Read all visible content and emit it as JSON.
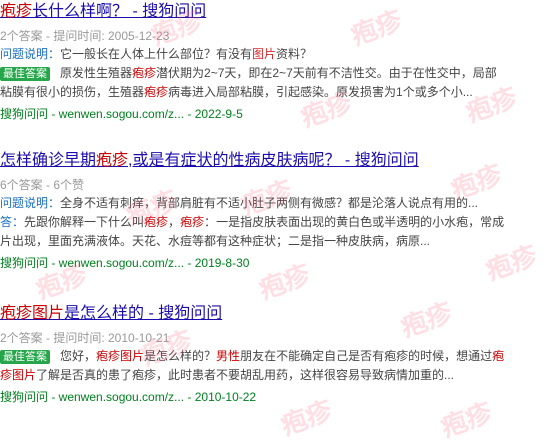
{
  "watermark_text": "疱疹",
  "watermark_color": "#ff5a78",
  "results": [
    {
      "title": {
        "hl": "疱疹",
        "rest": "长什么样啊？ - 搜狗问问"
      },
      "meta": "2个答案 - 提问时间: 2005-12-23",
      "question": {
        "label": "问题说明：",
        "pre": "它一般长在人体上什么部位？有没有",
        "hl": "图片",
        "post": "资料？"
      },
      "answer": {
        "badge": "最佳答案",
        "line1_pre": "原发性生殖器",
        "line1_hl": "疱疹",
        "line1_post": "潜伏期为2~7天，即在2~7天前有不洁性交。由于在性交中，局部",
        "line2_pre": "粘膜有很小的损伤，生殖器",
        "line2_hl": "疱疹",
        "line2_post": "病毒进入局部粘膜，引起感染。原发损害为1个或多个小..."
      },
      "source": "搜狗问问 - wenwen.sogou.com/z... - 2022-9-5"
    },
    {
      "title": {
        "pre": "怎样确诊早期",
        "hl": "疱疹",
        "rest": ",或是有症状的性病皮肤病呢？ - 搜狗问问"
      },
      "meta": "6个答案 - 6个赞",
      "question": {
        "label": "问题说明：",
        "text": "全身不适有刺痒，背部肩脏有不适小肚子两侧有微感？都是沦落人说点有用的..."
      },
      "answer": {
        "label": "答：",
        "line1_pre": "先跟你解释一下什么叫",
        "line1_hl1": "疱疹",
        "line1_mid": "，",
        "line1_hl2": "疱疹",
        "line1_post": "：一是指皮肤表面出现的黄白色或半透明的小水疱，常成",
        "line2": "片出现，里面充满液体。天花、水痘等都有这种症状；二是指一种皮肤病，病原..."
      },
      "source": "搜狗问问 - wenwen.sogou.com/z... - 2019-8-30"
    },
    {
      "title": {
        "hl": "疱疹图片",
        "rest": "是怎么样的 - 搜狗问问"
      },
      "meta": "2个答案 - 提问时间: 2010-10-21",
      "answer": {
        "badge": "最佳答案",
        "line1_pre": "您好，",
        "line1_hl1": "疱疹图片",
        "line1_mid": "是怎么样的？",
        "line1_hl2": "男性",
        "line1_post": "朋友在不能确定自己是否有疱疹的时候，想通过",
        "line1_hl3": "疱",
        "line2_hl": "疹图片",
        "line2_post": "了解是否真的患了疱疹，此时患者不要胡乱用药，这样很容易导致病情加重的..."
      },
      "source": "搜狗问问 - wenwen.sogou.com/z... - 2010-10-22"
    }
  ]
}
